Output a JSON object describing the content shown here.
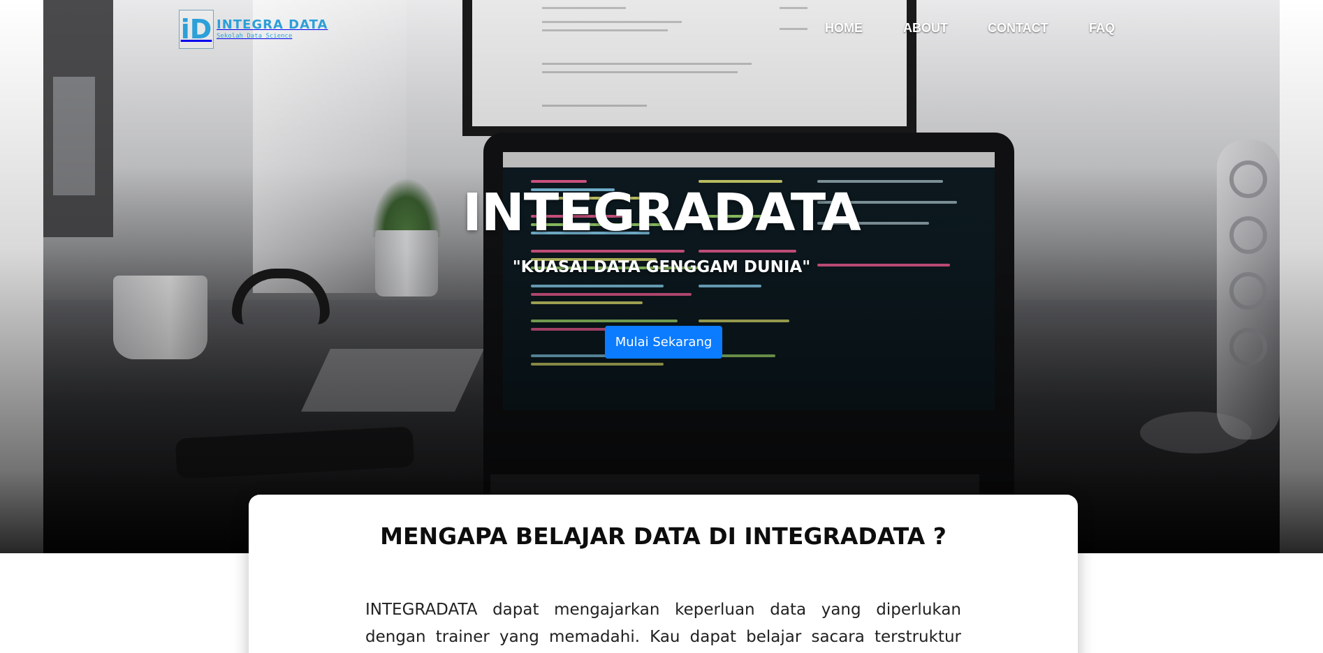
{
  "brand": {
    "logo_letters": "iD",
    "name": "INTEGRA DATA",
    "tagline": "Sekolah Data Science"
  },
  "nav": {
    "items": [
      {
        "label": "HOME"
      },
      {
        "label": "ABOUT"
      },
      {
        "label": "CONTACT"
      },
      {
        "label": "FAQ"
      }
    ]
  },
  "hero": {
    "title": "INTEGRADATA",
    "tagline": "\"KUASAI DATA GENGGAM DUNIA\"",
    "cta_label": "Mulai Sekarang"
  },
  "why": {
    "title": "MENGAPA BELAJAR DATA DI INTEGRADATA ?",
    "body": "INTEGRADATA dapat mengajarkan keperluan data yang diperlukan dengan trainer yang memadahi. Kau dapat belajar sacara terstruktur dengan studi"
  },
  "colors": {
    "accent": "#0b7bff",
    "logo": "#2ca0d8",
    "nav_text": "#ffffff"
  },
  "icons": {
    "logo": "integra-data-logo-icon"
  }
}
